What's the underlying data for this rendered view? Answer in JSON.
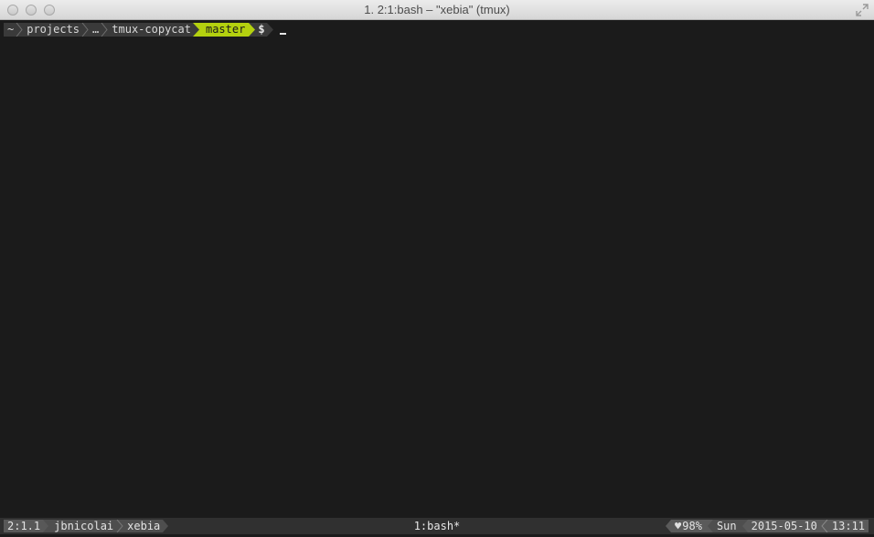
{
  "window": {
    "title": "1. 2:1:bash – \"xebia\" (tmux)"
  },
  "prompt": {
    "segments": [
      "~",
      "projects",
      "…",
      "tmux-copycat"
    ],
    "branch": "master",
    "symbol": "$",
    "accent_color": "#b4d10f"
  },
  "statusbar": {
    "session": "2:1.1",
    "user": "jbnicolai",
    "host": "xebia",
    "window_label": "1:bash*",
    "battery_icon": "heart-icon",
    "battery": "98%",
    "day": "Sun",
    "date": "2015-05-10",
    "time": "13:11"
  }
}
